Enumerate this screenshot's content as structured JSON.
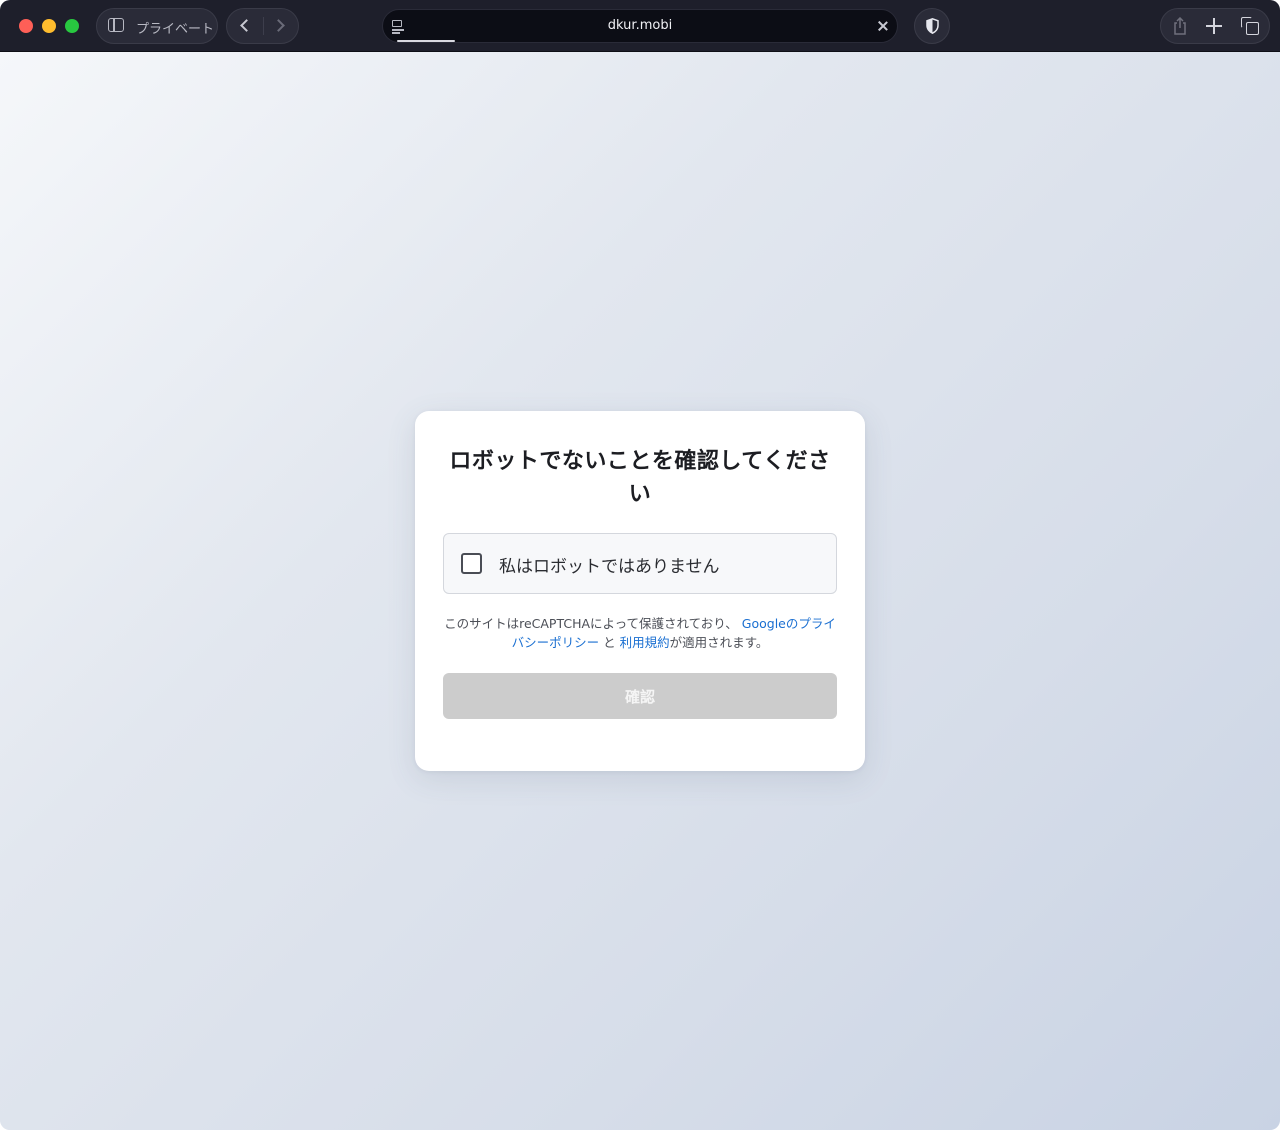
{
  "browser": {
    "sidebar_label": "プライベート",
    "url": "dkur.mobi",
    "icons": {
      "sidebar": "sidebar-icon",
      "back": "chevron-left-icon",
      "forward": "chevron-right-icon",
      "reader": "reader-icon",
      "close": "close-icon",
      "shield": "shield-icon",
      "share": "share-icon",
      "new_tab": "plus-icon",
      "tabs": "tabs-overview-icon"
    }
  },
  "captcha": {
    "title": "ロボットでないことを確認してください",
    "checkbox_label": "私はロボットではありません",
    "checkbox_checked": false,
    "notice_prefix": "このサイトはreCAPTCHAによって保護されており、",
    "privacy_link": "Googleのプライバシーポリシー",
    "notice_and": "と",
    "terms_link": "利用規約",
    "notice_suffix": "が適用されます。",
    "confirm_button": "確認",
    "confirm_enabled": false
  },
  "colors": {
    "link": "#1a6fd1",
    "button_disabled": "#cccccc",
    "toolbar": "#1e1f2b"
  }
}
